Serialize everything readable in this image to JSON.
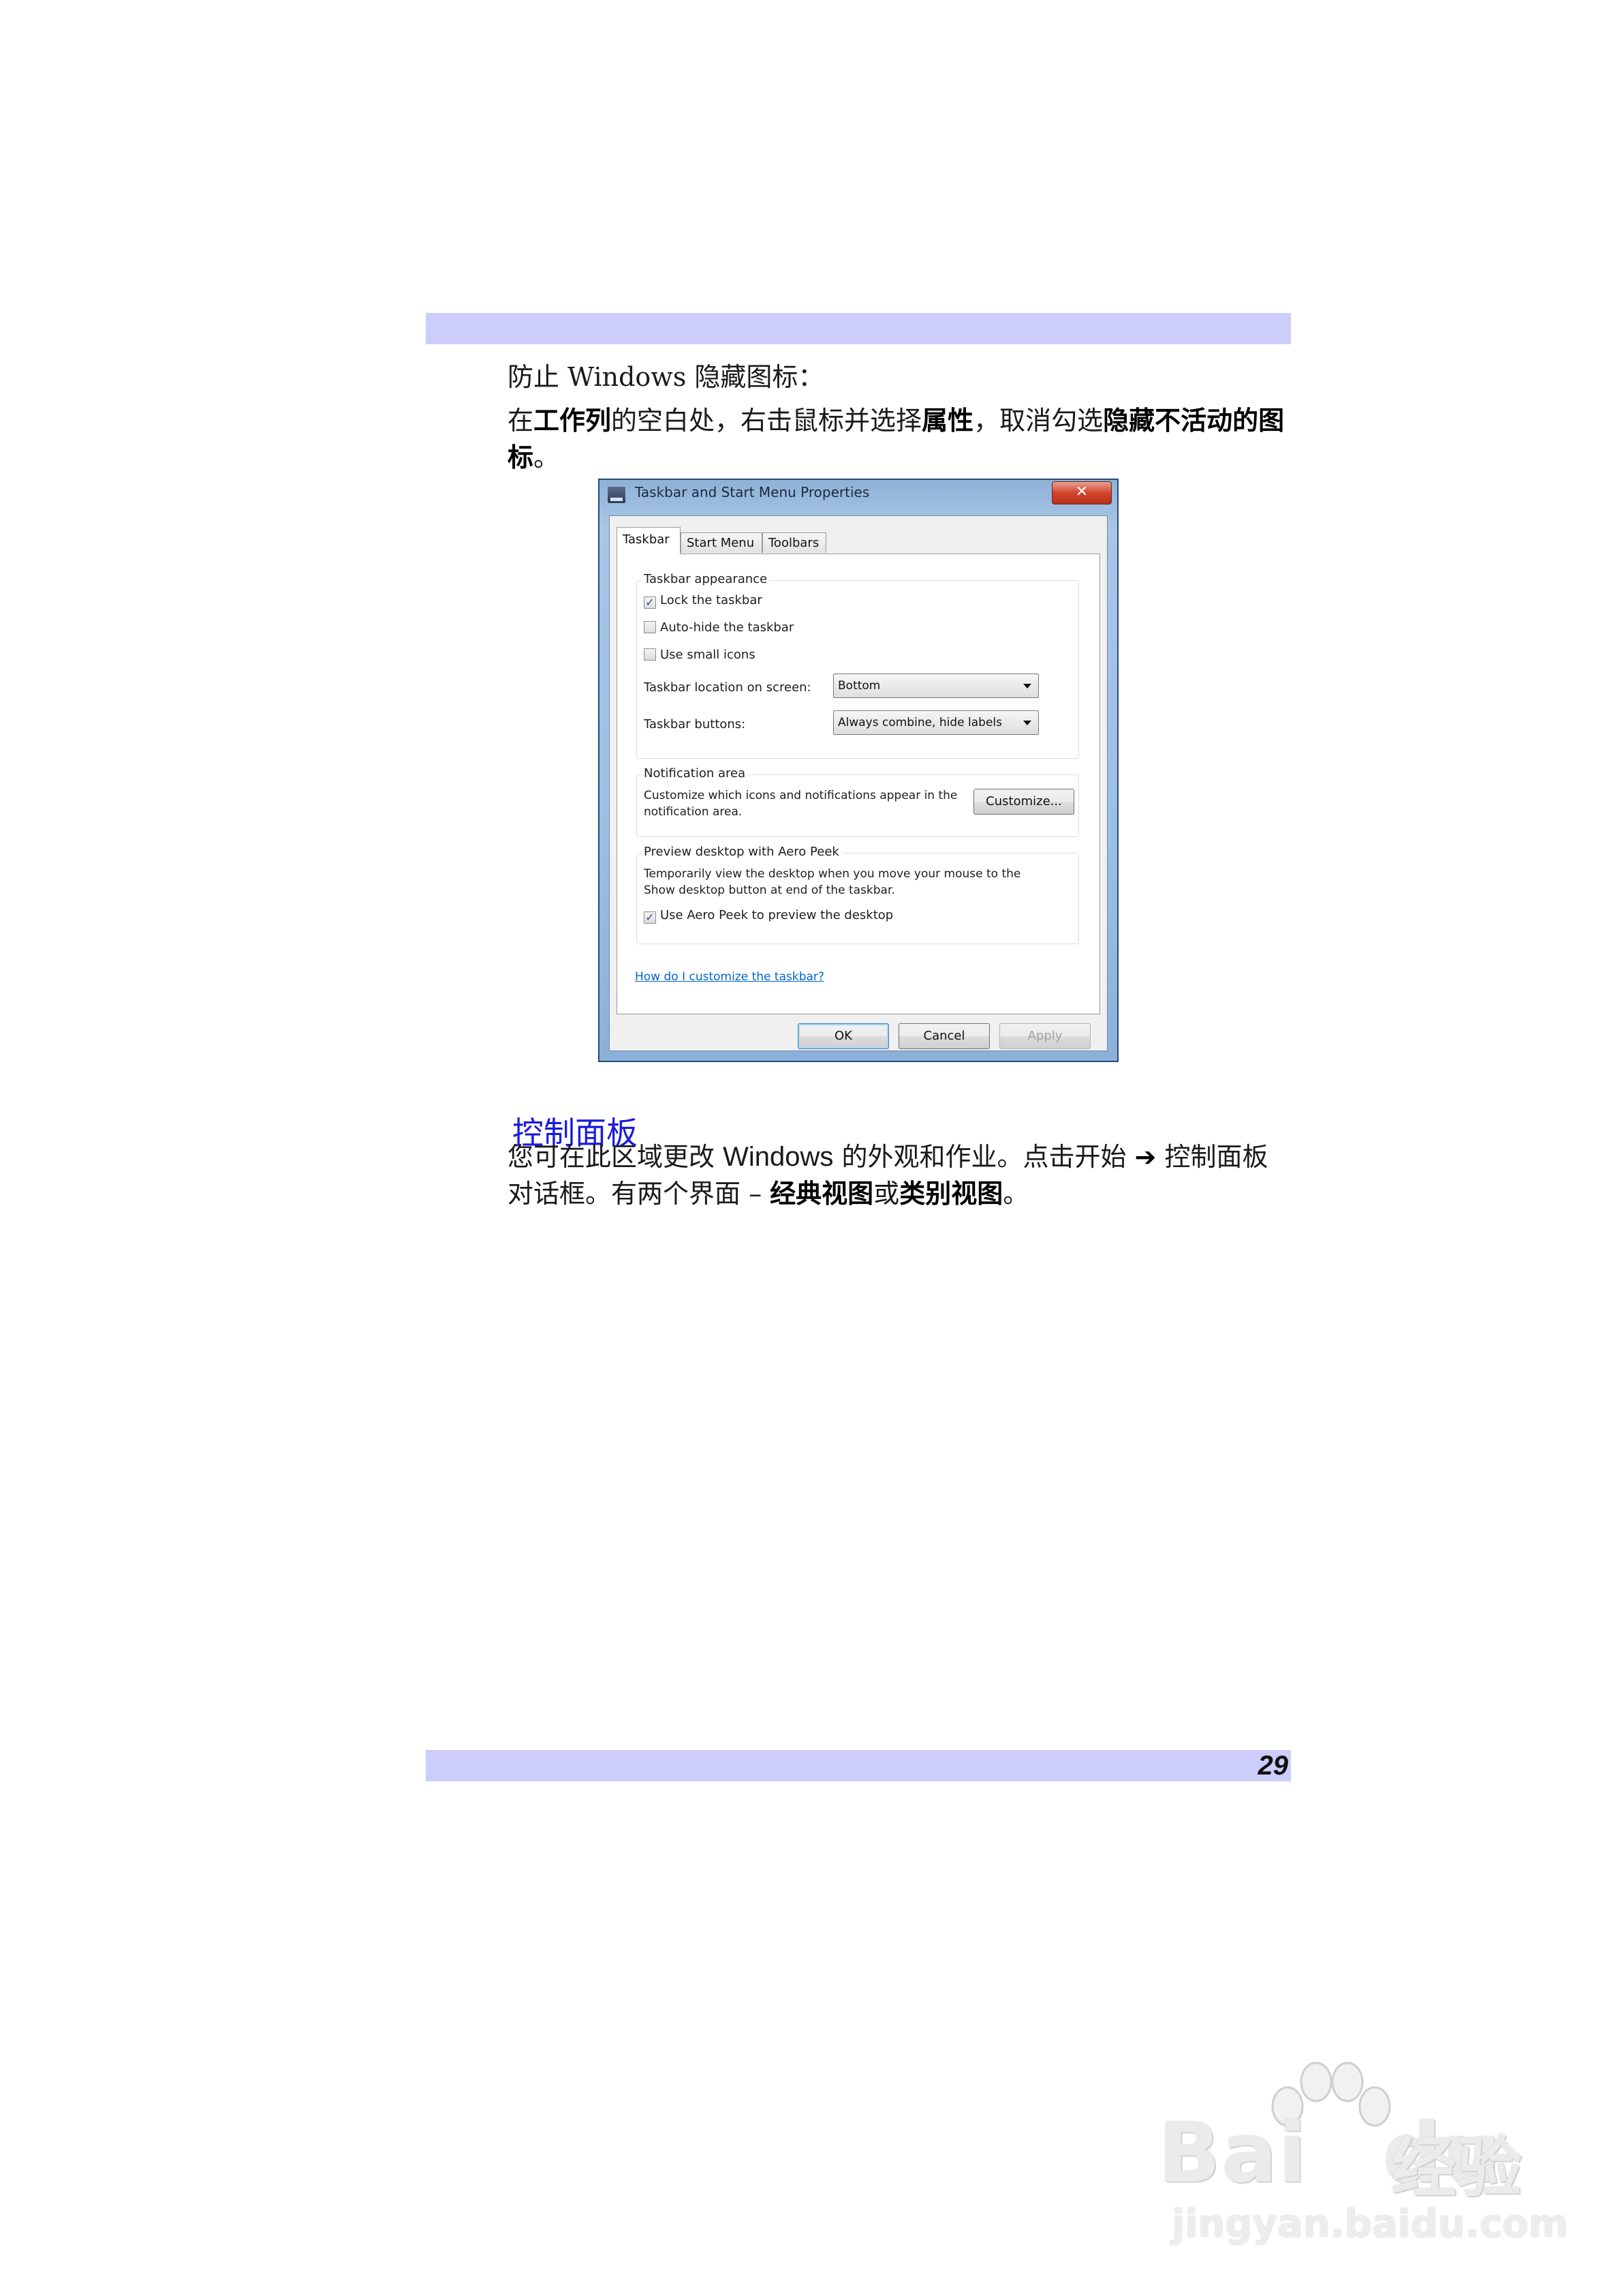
{
  "page": {
    "number": "29",
    "para1": "防止 Windows 隐藏图标：",
    "para2": {
      "t1": "在",
      "b1": "工作列",
      "t2": "的空白处，右击鼠标并选择",
      "b2": "属性",
      "t3": "，取消勾选",
      "b3": "隐藏不活动的图标",
      "t4": "。"
    },
    "section_heading": "控制面板",
    "para3": {
      "t1": "您可在此区域更改 ",
      "latin": "Windows",
      "t2": " 的外观和作业。点击开始 ",
      "arrow": "➔",
      "t3": " 控制面板对话框。有两个界面 – ",
      "b1": "经典视图",
      "t4": "或",
      "b2": "类别视图",
      "t5": "。"
    }
  },
  "dialog": {
    "title": "Taskbar and Start Menu Properties",
    "close_label": "✕",
    "tabs": [
      "Taskbar",
      "Start Menu",
      "Toolbars"
    ],
    "appearance": {
      "label": "Taskbar appearance",
      "lock": {
        "label": "Lock the taskbar",
        "checked": true
      },
      "autohide": {
        "label": "Auto-hide the taskbar",
        "checked": false
      },
      "small_icons": {
        "label": "Use small icons",
        "checked": false
      },
      "location_label": "Taskbar location on screen:",
      "location_value": "Bottom",
      "buttons_label": "Taskbar buttons:",
      "buttons_value": "Always combine, hide labels"
    },
    "notification": {
      "label": "Notification area",
      "desc": "Customize which icons and notifications appear in the notification area.",
      "customize_button": "Customize..."
    },
    "aero": {
      "label": "Preview desktop with Aero Peek",
      "desc": "Temporarily view the desktop when you move your mouse to the Show desktop button at end of the taskbar.",
      "peek": {
        "label": "Use Aero Peek to preview the desktop",
        "checked": true
      }
    },
    "help_link": "How do I customize the taskbar?",
    "ok": "OK",
    "cancel": "Cancel",
    "apply": "Apply"
  },
  "watermark": {
    "brand": "Bai",
    "brand2": "du",
    "cn": "经验",
    "url": "jingyan.baidu.com"
  },
  "colors": {
    "band": "#cccdfb",
    "heading": "#1a1adb",
    "link": "#0066cc"
  }
}
